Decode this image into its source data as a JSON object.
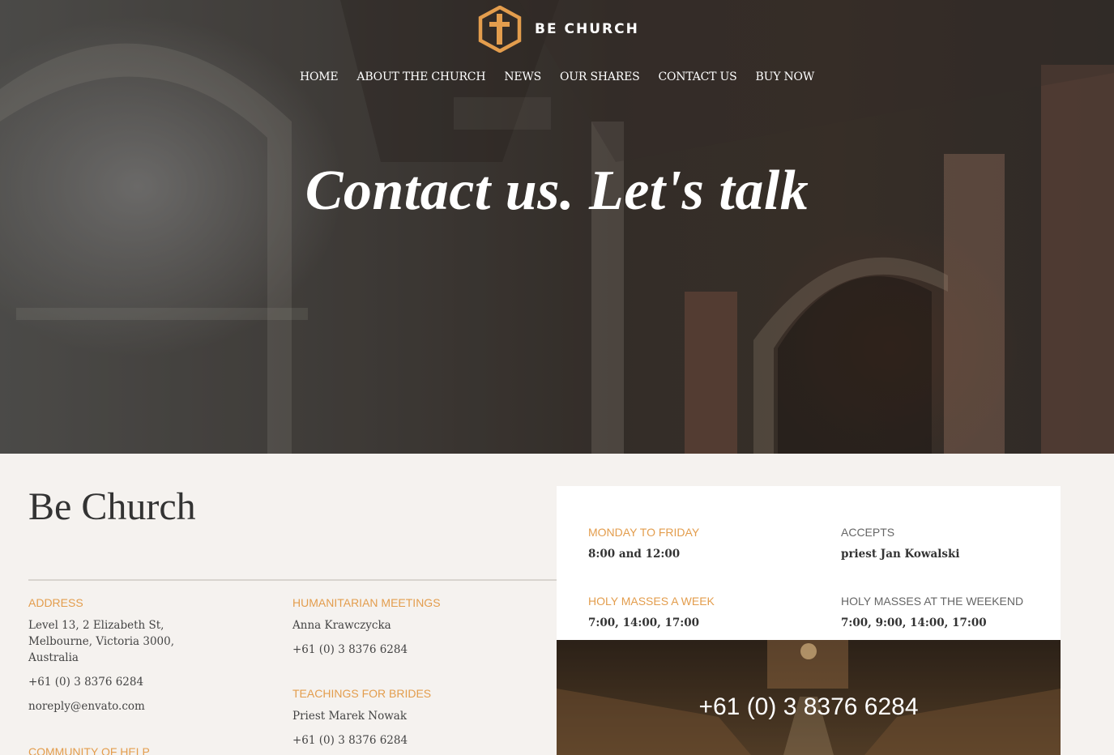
{
  "brand": {
    "name": "BE CHURCH",
    "accent": "#e39d4d"
  },
  "nav": [
    "HOME",
    "ABOUT THE CHURCH",
    "NEWS",
    "OUR SHARES",
    "CONTACT US",
    "BUY NOW"
  ],
  "hero": {
    "title": "Contact us. Let's talk"
  },
  "org": {
    "title": "Be Church"
  },
  "address": {
    "label": "ADDRESS",
    "line1": "Level 13, 2 Elizabeth St,",
    "line2": "Melbourne, Victoria 3000,",
    "line3": "Australia",
    "phone": "+61 (0) 3 8376 6284",
    "email": "noreply@envato.com"
  },
  "community": {
    "label": "COMMUNITY OF HELP"
  },
  "humanitarian": {
    "label": "HUMANITARIAN MEETINGS",
    "name": "Anna Krawczycka",
    "phone": "+61 (0) 3 8376 6284"
  },
  "brides": {
    "label": "TEACHINGS FOR BRIDES",
    "name": "Priest Marek Nowak",
    "phone": "+61 (0) 3 8376 6284"
  },
  "schedule": {
    "weekdays_label": "MONDAY TO FRIDAY",
    "weekdays_value": "8:00 and 12:00",
    "accepts_label": "ACCEPTS",
    "accepts_value": "priest Jan Kowalski",
    "masses_week_label": "HOLY MASSES A WEEK",
    "masses_week_value": "7:00, 14:00, 17:00",
    "masses_weekend_label": "HOLY MASSES AT THE WEEKEND",
    "masses_weekend_value": "7:00, 9:00, 14:00, 17:00"
  },
  "phone_panel": {
    "phone": "+61 (0) 3 8376 6284"
  }
}
